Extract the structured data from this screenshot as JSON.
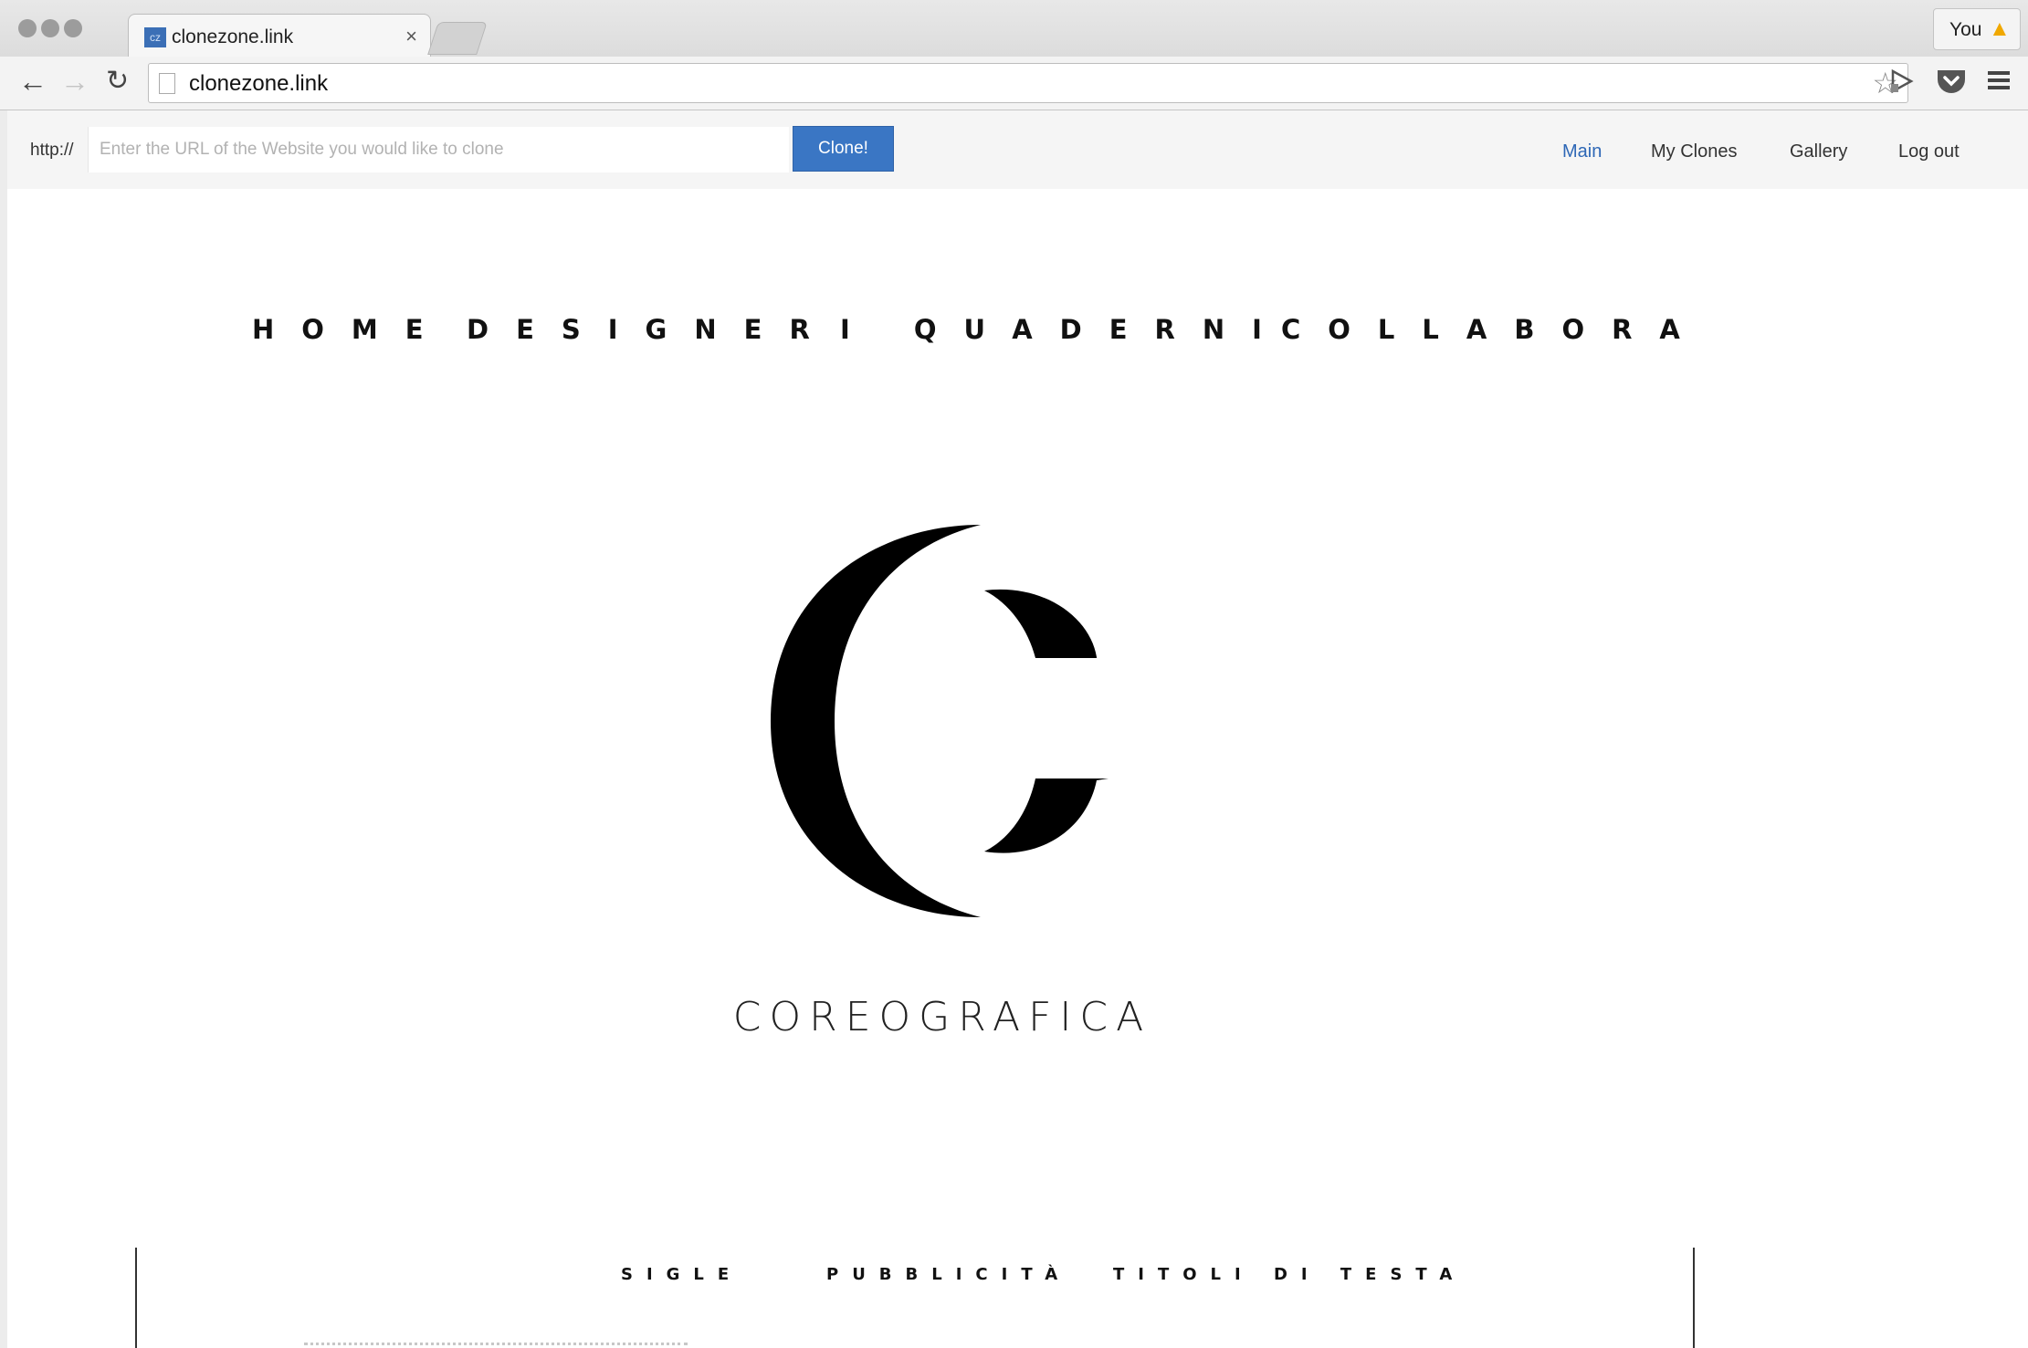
{
  "browser": {
    "tab_title": "clonezone.link",
    "favicon_text": "cz",
    "tab_close": "×",
    "profile_name": "You",
    "profile_badge": "warning-icon",
    "url": "clonezone.link",
    "icons": [
      "back-arrow-icon",
      "forward-arrow-icon",
      "reload-icon",
      "page-icon",
      "bookmark-star-icon",
      "cast-icon",
      "pocket-icon",
      "menu-icon"
    ]
  },
  "clone_bar": {
    "protocol_label": "http://",
    "url_placeholder": "Enter the URL of the Website you would like to clone",
    "clone_button": "Clone!",
    "nav": [
      "Main",
      "My Clones",
      "Gallery",
      "Log out"
    ],
    "active_nav": "Main",
    "accent_color": "#3a76c4"
  },
  "site": {
    "nav": [
      "HOME",
      "DESIGNER",
      "I QUADERNI",
      "COLLABORA"
    ],
    "brand_name": "COREOGRAFICA",
    "sub_nav": [
      "SIGLE",
      "PUBBLICITÀ",
      "TITOLI DI TESTA"
    ]
  }
}
